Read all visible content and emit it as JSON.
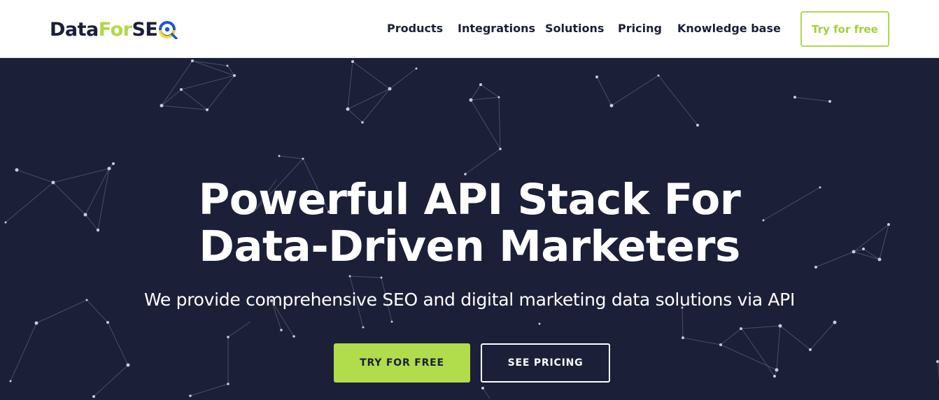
{
  "brand": {
    "name_part1": "Data",
    "name_part2": "For",
    "name_part3": "SE",
    "colors": {
      "dark": "#1b1f38",
      "accent": "#b1d84a",
      "blue": "#1e56d8",
      "yellow": "#f5d82a"
    },
    "logo_icon": "magnifier-o-icon"
  },
  "nav": {
    "items": [
      {
        "label": "Products"
      },
      {
        "label": "Integrations"
      },
      {
        "label": "Solutions"
      },
      {
        "label": "Pricing"
      },
      {
        "label": "Knowledge base"
      }
    ],
    "cta_label": "Try for free"
  },
  "hero": {
    "title_line1": "Powerful API Stack For",
    "title_line2": "Data-Driven Marketers",
    "subtitle": "We provide comprehensive SEO and digital marketing data solutions via API",
    "primary_cta": "TRY FOR FREE",
    "secondary_cta": "SEE PRICING",
    "background_color": "#1b1f38",
    "background_decoration": "network-graph"
  }
}
